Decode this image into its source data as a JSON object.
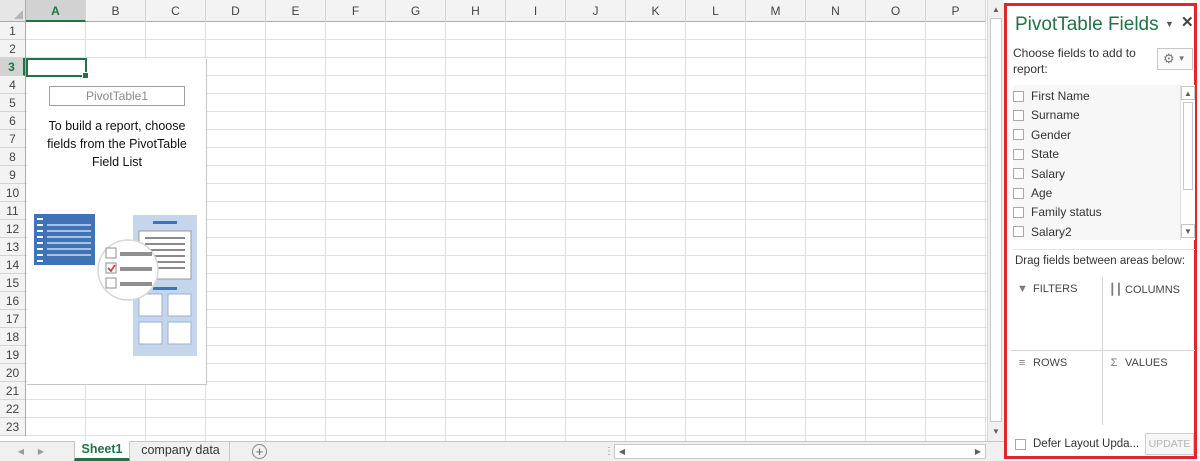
{
  "spreadsheet": {
    "columns": [
      "A",
      "B",
      "C",
      "D",
      "E",
      "F",
      "G",
      "H",
      "I",
      "J",
      "K",
      "L",
      "M",
      "N",
      "O",
      "P"
    ],
    "rows": [
      "1",
      "2",
      "3",
      "4",
      "5",
      "6",
      "7",
      "8",
      "9",
      "10",
      "11",
      "12",
      "13",
      "14",
      "15",
      "16",
      "17",
      "18",
      "19",
      "20",
      "21",
      "22",
      "23"
    ],
    "selected_column": "A",
    "selected_row": "3"
  },
  "pivot_placeholder": {
    "name": "PivotTable1",
    "instructions": "To build a report, choose fields from the PivotTable Field List"
  },
  "sheet_tabs": {
    "tabs": [
      "Sheet1",
      "company data"
    ],
    "active": "Sheet1",
    "add_icon": "plus-circle-icon"
  },
  "pane": {
    "title": "PivotTable Fields",
    "choose_label": "Choose fields to add to report:",
    "fields": [
      {
        "label": "First Name",
        "checked": false
      },
      {
        "label": "Surname",
        "checked": false
      },
      {
        "label": "Gender",
        "checked": false
      },
      {
        "label": "State",
        "checked": false
      },
      {
        "label": "Salary",
        "checked": false
      },
      {
        "label": "Age",
        "checked": false
      },
      {
        "label": "Family status",
        "checked": false
      },
      {
        "label": "Salary2",
        "checked": false
      }
    ],
    "drag_label": "Drag fields between areas below:",
    "areas": {
      "filters": "FILTERS",
      "columns": "COLUMNS",
      "rows": "ROWS",
      "values": "VALUES"
    },
    "defer_label": "Defer Layout Upda...",
    "update_label": "UPDATE",
    "accent_color": "#217346",
    "highlight_border_color": "#e3262b"
  }
}
